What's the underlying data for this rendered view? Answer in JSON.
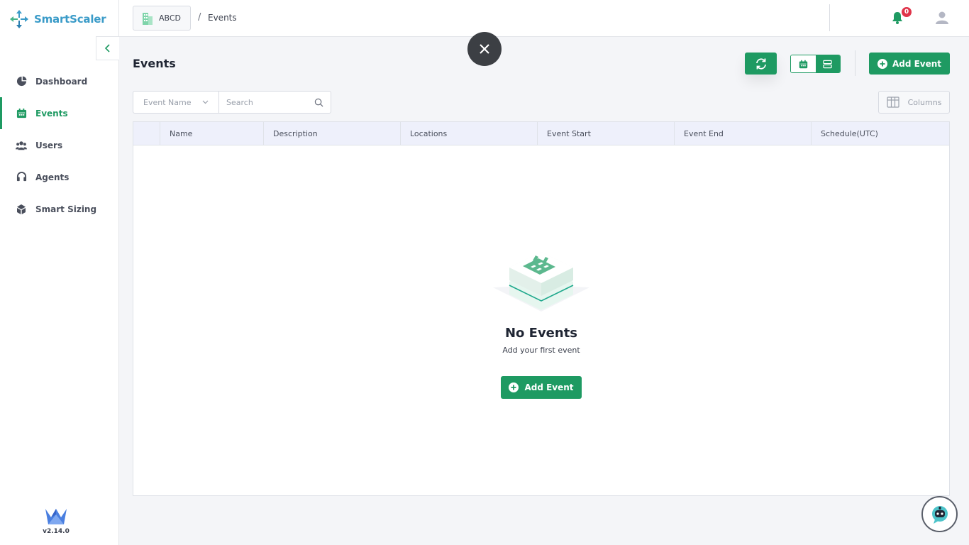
{
  "app": {
    "name": "SmartScaler",
    "version": "v2.14.0"
  },
  "sidebar": {
    "items": [
      {
        "label": "Dashboard",
        "icon": "pie-chart-icon",
        "active": false
      },
      {
        "label": "Events",
        "icon": "calendar-icon",
        "active": true
      },
      {
        "label": "Users",
        "icon": "users-icon",
        "active": false
      },
      {
        "label": "Agents",
        "icon": "headset-icon",
        "active": false
      },
      {
        "label": "Smart Sizing",
        "icon": "cube-icon",
        "active": false
      }
    ]
  },
  "topbar": {
    "org": "ABCD",
    "breadcrumb_sep": "/",
    "breadcrumb_current": "Events",
    "notification_count": "0"
  },
  "page": {
    "title": "Events",
    "add_event_label": "Add Event"
  },
  "filter": {
    "field_label": "Event Name",
    "search_placeholder": "Search",
    "columns_label": "Columns"
  },
  "table": {
    "columns": [
      "Name",
      "Description",
      "Locations",
      "Event Start",
      "Event End",
      "Schedule(UTC)"
    ]
  },
  "empty_state": {
    "title": "No Events",
    "subtitle": "Add your first event",
    "button_label": "Add Event"
  },
  "colors": {
    "primary": "#1e9a62",
    "badge": "#e0344a",
    "logo": "#3a9bc8",
    "table_header": "#eef0fb"
  }
}
